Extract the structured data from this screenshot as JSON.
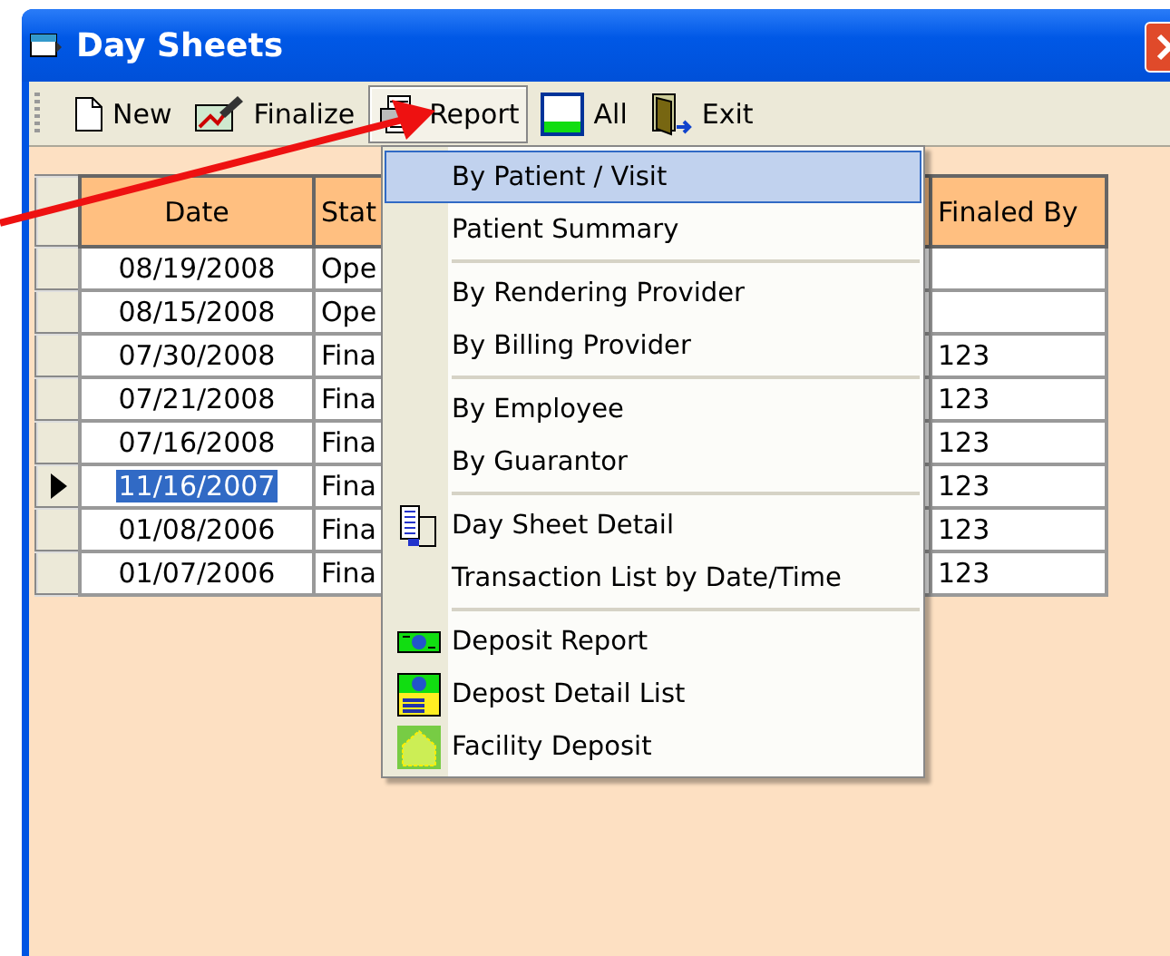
{
  "window": {
    "title": "Day Sheets"
  },
  "toolbar": [
    {
      "label": "New",
      "kind": "new",
      "pressed": false
    },
    {
      "label": "Finalize",
      "kind": "finalize",
      "pressed": false
    },
    {
      "label": "Report",
      "kind": "report",
      "pressed": true
    },
    {
      "label": "All",
      "kind": "all",
      "pressed": false
    },
    {
      "label": "Exit",
      "kind": "exit",
      "pressed": false
    }
  ],
  "table": {
    "columns": [
      "Date",
      "Stat",
      "Finaled By"
    ],
    "rows": [
      {
        "cells": [
          "08/19/2008",
          "Ope",
          ""
        ],
        "selected": false
      },
      {
        "cells": [
          "08/15/2008",
          "Ope",
          ""
        ],
        "selected": false
      },
      {
        "cells": [
          "07/30/2008",
          "Fina",
          "123"
        ],
        "selected": false
      },
      {
        "cells": [
          "07/21/2008",
          "Fina",
          "123"
        ],
        "selected": false
      },
      {
        "cells": [
          "07/16/2008",
          "Fina",
          "123"
        ],
        "selected": false
      },
      {
        "cells": [
          "11/16/2007",
          "Fina",
          "123"
        ],
        "selected": true
      },
      {
        "cells": [
          "01/08/2006",
          "Fina",
          "123"
        ],
        "selected": false
      },
      {
        "cells": [
          "01/07/2006",
          "Fina",
          "123"
        ],
        "selected": false
      }
    ]
  },
  "menu": {
    "groups": [
      [
        {
          "label": "By Patient / Visit",
          "kind": "plain",
          "selected": true
        },
        {
          "label": "Patient Summary",
          "kind": "plain",
          "selected": false
        }
      ],
      [
        {
          "label": "By Rendering Provider",
          "kind": "plain",
          "selected": false
        },
        {
          "label": "By Billing Provider",
          "kind": "plain",
          "selected": false
        }
      ],
      [
        {
          "label": "By Employee",
          "kind": "plain",
          "selected": false
        },
        {
          "label": "By Guarantor",
          "kind": "plain",
          "selected": false
        }
      ],
      [
        {
          "label": "Day Sheet Detail",
          "kind": "detail",
          "selected": false
        },
        {
          "label": "Transaction List by Date/Time",
          "kind": "plain",
          "selected": false
        }
      ],
      [
        {
          "label": "Deposit Report",
          "kind": "deposit",
          "selected": false
        },
        {
          "label": "Depost Detail List",
          "kind": "deposit-list",
          "selected": false
        },
        {
          "label": "Facility Deposit",
          "kind": "facility",
          "selected": false
        }
      ]
    ]
  }
}
